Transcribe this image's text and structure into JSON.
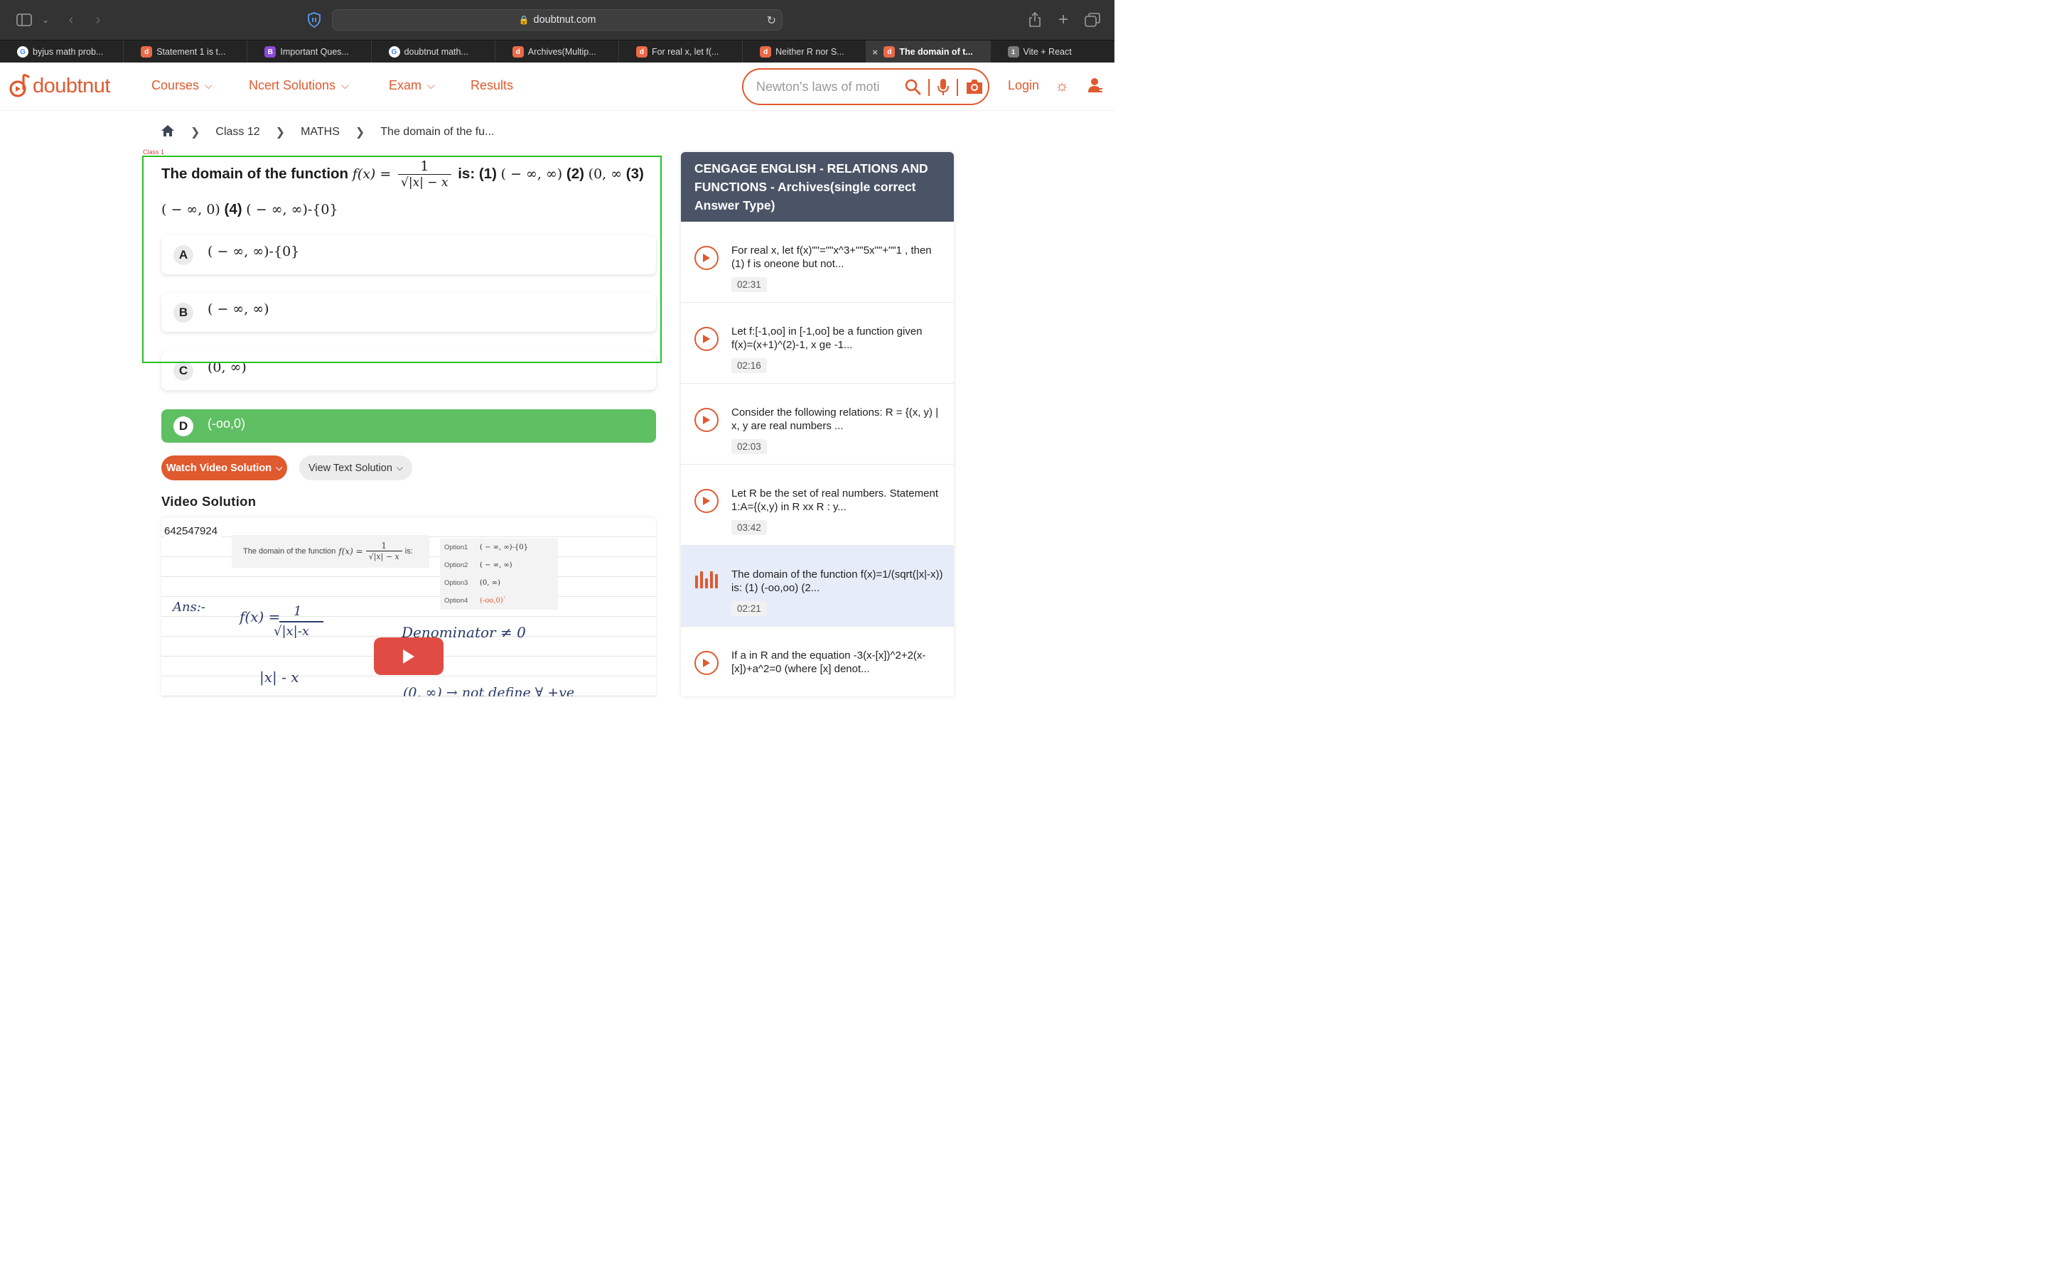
{
  "browser": {
    "url": "doubtnut.com",
    "tabs": [
      {
        "label": "byjus math prob...",
        "favicon": "google-icon",
        "active": false
      },
      {
        "label": "Statement 1 is t...",
        "favicon": "doubtnut-icon",
        "active": false
      },
      {
        "label": "Important Ques...",
        "favicon": "byjus-icon",
        "active": false
      },
      {
        "label": "doubtnut math...",
        "favicon": "google-icon",
        "active": false
      },
      {
        "label": "Archives(Multip...",
        "favicon": "doubtnut-icon",
        "active": false
      },
      {
        "label": "For real x, let f(...",
        "favicon": "doubtnut-icon",
        "active": false
      },
      {
        "label": "Neither R nor S...",
        "favicon": "doubtnut-icon",
        "active": false
      },
      {
        "label": "The domain of t...",
        "favicon": "doubtnut-icon",
        "active": true
      },
      {
        "label": "Vite + React",
        "favicon": "number-1-icon",
        "favicon_text": "1",
        "active": false
      }
    ]
  },
  "header": {
    "logo_text": "doubtnut",
    "nav": [
      {
        "label": "Courses",
        "dropdown": true
      },
      {
        "label": "Ncert Solutions",
        "dropdown": true
      },
      {
        "label": "Exam",
        "dropdown": true
      },
      {
        "label": "Results",
        "dropdown": false
      }
    ],
    "search_placeholder": "Newton's laws of moti",
    "login_label": "Login"
  },
  "breadcrumb": [
    "Class 12",
    "MATHS",
    "The domain of the fu..."
  ],
  "class_tag": "Class 1",
  "question": {
    "prefix": "The domain of the function",
    "fx": "f(x) =",
    "numerator": "1",
    "denominator": "√|x| − x",
    "is_label": "is: (1)",
    "opt1": "( − ∞, ∞)",
    "label2": "(2)",
    "opt2": "(0, ∞",
    "label3": "(3)",
    "opt3": "( − ∞, 0)",
    "label4": "(4)",
    "opt4": "( − ∞, ∞)-{0}"
  },
  "options": [
    {
      "letter": "A",
      "text": "( − ∞, ∞)-{0}",
      "correct": false
    },
    {
      "letter": "B",
      "text": "( − ∞, ∞)",
      "correct": false
    },
    {
      "letter": "C",
      "text": "(0, ∞)",
      "correct": false
    },
    {
      "letter": "D",
      "text": "(-oo,0)",
      "correct": true
    }
  ],
  "buttons": {
    "watch_video": "Watch Video Solution",
    "view_text": "View Text Solution"
  },
  "video": {
    "heading": "Video Solution",
    "id": "642547924",
    "card_prefix": "The domain of the function",
    "card_fx": "f(x) =",
    "card_num": "1",
    "card_den": "√|x| − x",
    "card_suffix": "is:",
    "options": [
      {
        "label": "Option1",
        "value": "( − ∞, ∞)-{0}"
      },
      {
        "label": "Option2",
        "value": "( − ∞, ∞)"
      },
      {
        "label": "Option3",
        "value": "(0, ∞)"
      },
      {
        "label": "Option4",
        "value": "(-oo,0)`"
      }
    ],
    "handwriting": {
      "ans": "Ans:-",
      "fx": "f(x) =",
      "num": "1",
      "den": "√|x|-x",
      "denominator_note": "Denominator ≠ 0",
      "line3": "|x| - x",
      "line4": "(0, ∞) → not define ∀ +ve"
    }
  },
  "sidebar": {
    "header": "CENGAGE ENGLISH  -  RELATIONS AND FUNCTIONS  -  Archives(single correct Answer Type)",
    "items": [
      {
        "text": "For real x, let f(x)\"\"=\"\"x^3+\"\"5x\"\"+\"\"1 , then (1) f is oneone but not...",
        "time": "02:31",
        "active": false
      },
      {
        "text": "Let f:[-1,oo] in [-1,oo] be a function given f(x)=(x+1)^(2)-1, x ge -1...",
        "time": "02:16",
        "active": false
      },
      {
        "text": "Consider the following relations: R = {(x, y) | x, y are real numbers ...",
        "time": "02:03",
        "active": false
      },
      {
        "text": "Let R be the set of real numbers. Statement 1:A={(x,y) in R xx R : y...",
        "time": "03:42",
        "active": false
      },
      {
        "text": "The domain of the function f(x)=1/(sqrt(|x|-x)) is: (1) (-oo,oo) (2...",
        "time": "02:21",
        "active": true
      },
      {
        "text": "If a in R and the equation -3(x-[x])^2+2(x-[x])+a^2=0 (where [x] denot...",
        "time": "",
        "active": false
      }
    ]
  },
  "colors": {
    "brand": "#e05a2f",
    "correct": "#5fbf63",
    "sidebar_header": "#4b5466",
    "highlight_box": "#24c224"
  }
}
